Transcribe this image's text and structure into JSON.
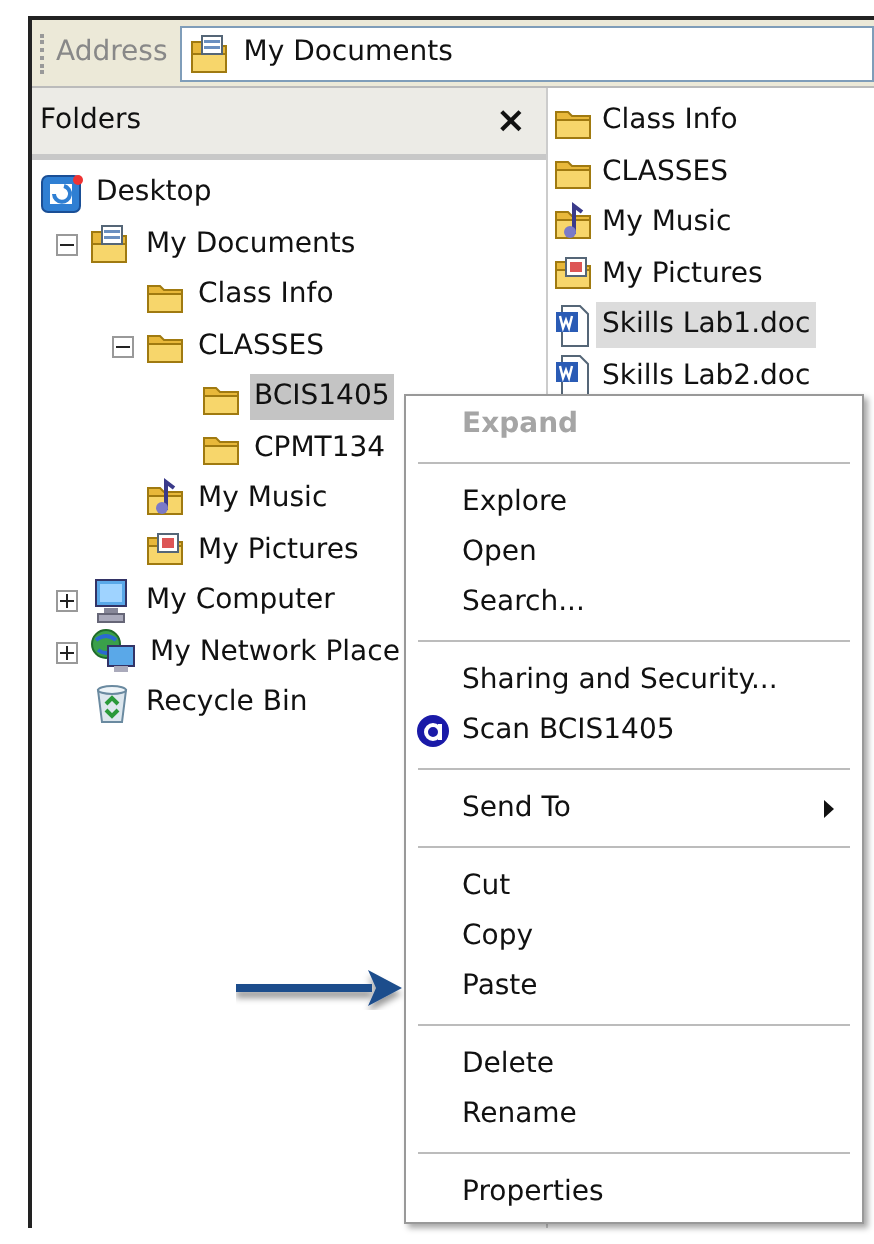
{
  "address_bar": {
    "label": "Address",
    "value": "My Documents",
    "kind": "documents"
  },
  "folders_pane": {
    "title": "Folders",
    "close": "×",
    "tree": [
      {
        "label": "Desktop",
        "kind": "desktop",
        "selected": false,
        "children": [
          {
            "label": "My Documents",
            "kind": "documents",
            "selected": false,
            "expanded": true,
            "children": [
              {
                "label": "Class Info",
                "kind": "folder",
                "selected": false
              },
              {
                "label": "CLASSES",
                "kind": "folder",
                "selected": false,
                "expanded": true,
                "children": [
                  {
                    "label": "BCIS1405",
                    "kind": "folder",
                    "selected": true
                  },
                  {
                    "label": "CPMT134",
                    "kind": "folder",
                    "selected": false
                  }
                ]
              },
              {
                "label": "My Music",
                "kind": "music",
                "selected": false
              },
              {
                "label": "My Pictures",
                "kind": "pictures",
                "selected": false
              }
            ]
          },
          {
            "label": "My Computer",
            "kind": "computer",
            "selected": false,
            "expanded": false
          },
          {
            "label": "My Network Place",
            "kind": "network",
            "selected": false,
            "expanded": false
          },
          {
            "label": "Recycle Bin",
            "kind": "recycle",
            "selected": false
          }
        ]
      }
    ]
  },
  "file_list": [
    {
      "label": "Class Info",
      "kind": "folder",
      "selected": false
    },
    {
      "label": "CLASSES",
      "kind": "folder",
      "selected": false
    },
    {
      "label": "My Music",
      "kind": "music",
      "selected": false
    },
    {
      "label": "My Pictures",
      "kind": "pictures",
      "selected": false
    },
    {
      "label": "Skills Lab1.doc",
      "kind": "doc",
      "selected": true
    },
    {
      "label": "Skills Lab2.doc",
      "kind": "doc",
      "selected": false
    }
  ],
  "context_menu": [
    {
      "kind": "item",
      "label": "Expand",
      "disabled": true,
      "default": true,
      "submenu": false
    },
    {
      "kind": "separator"
    },
    {
      "kind": "item",
      "label": "Explore",
      "disabled": false,
      "default": false,
      "submenu": false
    },
    {
      "kind": "item",
      "label": "Open",
      "disabled": false,
      "default": false,
      "submenu": false
    },
    {
      "kind": "item",
      "label": "Search...",
      "disabled": false,
      "default": false,
      "submenu": false
    },
    {
      "kind": "separator"
    },
    {
      "kind": "item",
      "label": "Sharing and Security...",
      "disabled": false,
      "default": false,
      "submenu": false
    },
    {
      "kind": "scan_item",
      "label": "Scan BCIS1405",
      "disabled": false,
      "default": false,
      "submenu": false
    },
    {
      "kind": "separator"
    },
    {
      "kind": "item",
      "label": "Send To",
      "disabled": false,
      "default": false,
      "submenu": true
    },
    {
      "kind": "separator"
    },
    {
      "kind": "item",
      "label": "Cut",
      "disabled": false,
      "default": false,
      "submenu": false
    },
    {
      "kind": "item",
      "label": "Copy",
      "disabled": false,
      "default": false,
      "submenu": false
    },
    {
      "kind": "item",
      "label": "Paste",
      "disabled": false,
      "default": false,
      "submenu": false
    },
    {
      "kind": "separator"
    },
    {
      "kind": "item",
      "label": "Delete",
      "disabled": false,
      "default": false,
      "submenu": false
    },
    {
      "kind": "item",
      "label": "Rename",
      "disabled": false,
      "default": false,
      "submenu": false
    },
    {
      "kind": "separator"
    },
    {
      "kind": "item",
      "label": "Properties",
      "disabled": false,
      "default": false,
      "submenu": false
    }
  ]
}
